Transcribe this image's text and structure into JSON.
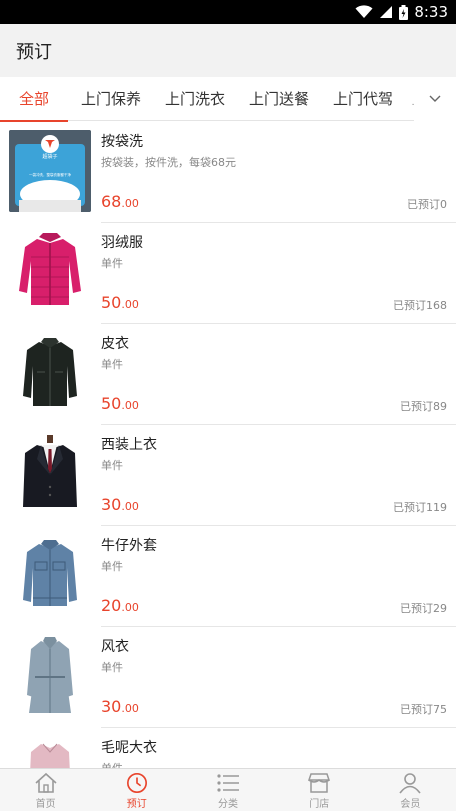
{
  "status_bar": {
    "time": "8:33"
  },
  "header": {
    "title": "预订"
  },
  "tabs": [
    {
      "label": "全部",
      "active": true
    },
    {
      "label": "上门保养"
    },
    {
      "label": "上门洗衣"
    },
    {
      "label": "上门送餐"
    },
    {
      "label": "上门代驾"
    },
    {
      "label": "上"
    }
  ],
  "items": [
    {
      "name": "按袋洗",
      "desc": "按袋装，按件洗，每袋68元",
      "price_int": "68",
      "price_dec": ".00",
      "sold": "已预订0",
      "image_icon": "laundry-bag-image",
      "image_text_brand": "超袋子",
      "image_text_tagline": "一袋冲洗，整袋衣服都干净"
    },
    {
      "name": "羽绒服",
      "desc": "单件",
      "price_int": "50",
      "price_dec": ".00",
      "sold": "已预订168",
      "image_icon": "down-jacket-image"
    },
    {
      "name": "皮衣",
      "desc": "单件",
      "price_int": "50",
      "price_dec": ".00",
      "sold": "已预订89",
      "image_icon": "leather-jacket-image"
    },
    {
      "name": "西装上衣",
      "desc": "单件",
      "price_int": "30",
      "price_dec": ".00",
      "sold": "已预订119",
      "image_icon": "suit-jacket-image"
    },
    {
      "name": "牛仔外套",
      "desc": "单件",
      "price_int": "20",
      "price_dec": ".00",
      "sold": "已预订29",
      "image_icon": "denim-jacket-image"
    },
    {
      "name": "风衣",
      "desc": "单件",
      "price_int": "30",
      "price_dec": ".00",
      "sold": "已预订75",
      "image_icon": "trench-coat-image"
    },
    {
      "name": "毛呢大衣",
      "desc": "单件",
      "price_int": "",
      "price_dec": "",
      "sold": "",
      "image_icon": "wool-coat-image"
    }
  ],
  "bottom_nav": [
    {
      "label": "首页",
      "icon": "home-icon"
    },
    {
      "label": "预订",
      "icon": "clock-icon",
      "active": true
    },
    {
      "label": "分类",
      "icon": "list-icon"
    },
    {
      "label": "门店",
      "icon": "store-icon"
    },
    {
      "label": "会员",
      "icon": "user-icon"
    }
  ],
  "colors": {
    "accent": "#e8442c",
    "muted": "#999999"
  }
}
